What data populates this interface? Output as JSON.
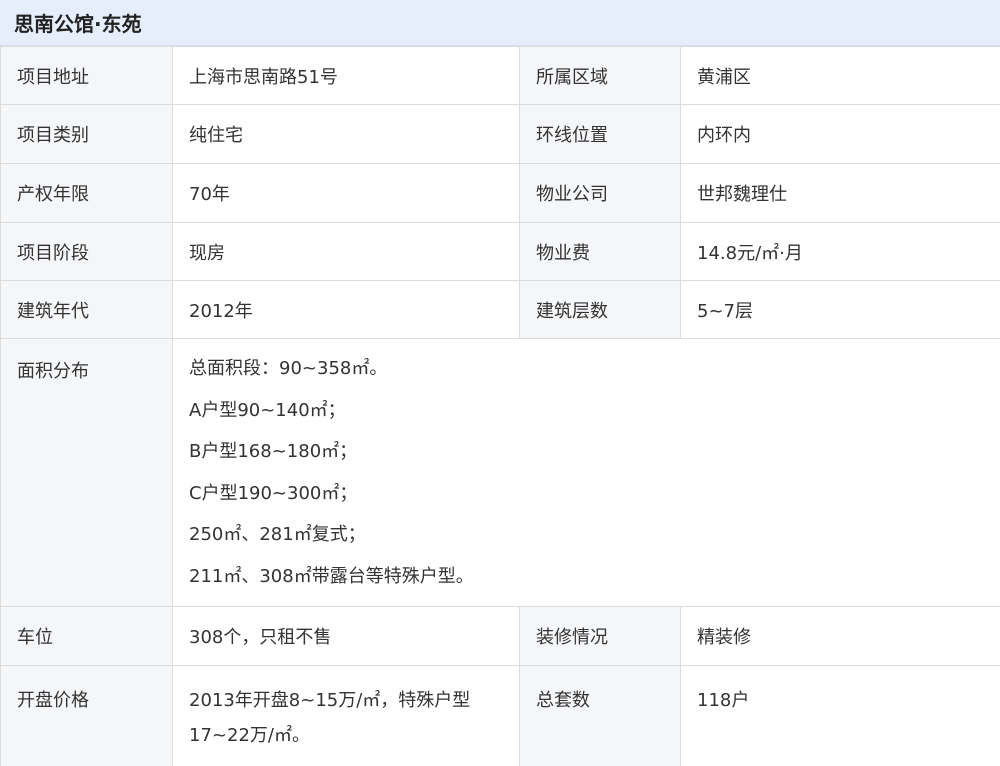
{
  "title": "思南公馆·东苑",
  "rows": [
    {
      "label1": "项目地址",
      "value1": "上海市思南路51号",
      "label2": "所属区域",
      "value2": "黄浦区"
    },
    {
      "label1": "项目类别",
      "value1": "纯住宅",
      "label2": "环线位置",
      "value2": "内环内"
    },
    {
      "label1": "产权年限",
      "value1": "70年",
      "label2": "物业公司",
      "value2": "世邦魏理仕"
    },
    {
      "label1": "项目阶段",
      "value1": "现房",
      "label2": "物业费",
      "value2": "14.8元/㎡·月"
    },
    {
      "label1": "建筑年代",
      "value1": "2012年",
      "label2": "建筑层数",
      "value2": "5~7层"
    }
  ],
  "area": {
    "label": "面积分布",
    "lines": [
      "总面积段：90~358㎡。",
      "A户型90~140㎡；",
      "B户型168~180㎡；",
      "C户型190~300㎡；",
      "250㎡、281㎡复式；",
      "211㎡、308㎡带露台等特殊户型。"
    ]
  },
  "parking": {
    "label1": "车位",
    "value1": "308个，只租不售",
    "label2": "装修情况",
    "value2": "精装修"
  },
  "price": {
    "label1": "开盘价格",
    "value1": "2013年开盘8~15万/㎡，特殊户型17~22万/㎡。",
    "label2": "总套数",
    "value2": "118户"
  }
}
